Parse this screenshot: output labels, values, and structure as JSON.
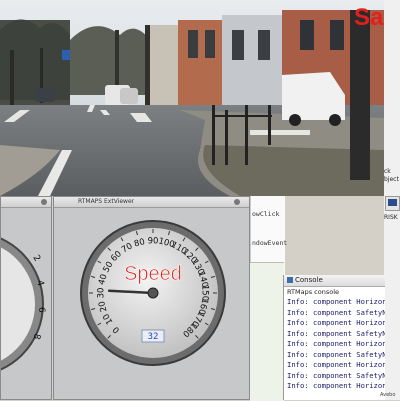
{
  "header": {
    "title": "Safety"
  },
  "left_gauge_window": {
    "title": "RTMAPS Viewer",
    "tick_labels": [
      "2",
      "4",
      "6",
      "8"
    ]
  },
  "speed_gauge_window": {
    "title": "RTMAPS ExtViewer",
    "gauge_label": "Speed",
    "ticks": [
      "0",
      "10",
      "20",
      "30",
      "40",
      "50",
      "60",
      "70",
      "80",
      "90",
      "100",
      "110",
      "120",
      "130",
      "140",
      "150",
      "160",
      "170",
      "180"
    ],
    "digital_value": "32",
    "needle_value": 32
  },
  "editor": {
    "lines": [
      "owClick",
      "ndowEvent"
    ]
  },
  "console": {
    "tab_label": "Console",
    "header": "RTMaps console",
    "lines": [
      "Info: component Horizon_Ele",
      "Info: component SafetyNex",
      "Info: component Horizon_Ele",
      "Info: component SafetyNex",
      "Info: component Horizon_Ele",
      "Info: component SafetyNex",
      "Info: component Horizon_Ele",
      "Info: component SafetyNex",
      "Info: component Horizon_Ele"
    ]
  },
  "right_panel": {
    "labels": [
      "ck",
      "bject",
      "RISK"
    ],
    "status": "Avebo"
  },
  "colors": {
    "title_red": "#e0201c",
    "gauge_label_red": "#d8291f",
    "digital_blue": "#2a3fb5"
  }
}
